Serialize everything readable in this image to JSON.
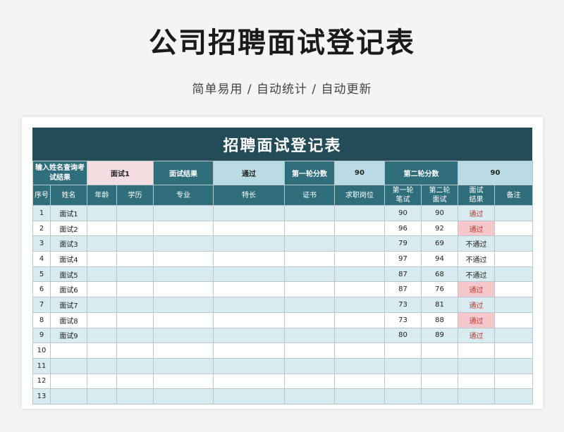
{
  "page": {
    "title": "公司招聘面试登记表",
    "subtitle": "简单易用 / 自动统计 / 自动更新"
  },
  "sheet": {
    "banner": "招聘面试登记表",
    "query": {
      "label": "输入姓名查询考试结果",
      "name_value": "面试1",
      "result_label": "面试结果",
      "result_value": "通过",
      "round1_label": "第一轮分数",
      "round1_value": "90",
      "round2_label": "第二轮分数",
      "round2_value": "90"
    },
    "columns": {
      "seq": "序号",
      "name": "姓名",
      "age": "年龄",
      "edu": "学历",
      "major": "专业",
      "skill": "特长",
      "cert": "证书",
      "position": "求职岗位",
      "round1": "第一轮笔试",
      "round2": "第二轮面试",
      "result": "面试结果",
      "remark": "备注"
    },
    "rows": [
      {
        "seq": "1",
        "name": "面试1",
        "r1": "90",
        "r2": "90",
        "result": "通过",
        "hl": false
      },
      {
        "seq": "2",
        "name": "面试2",
        "r1": "96",
        "r2": "92",
        "result": "通过",
        "hl": true
      },
      {
        "seq": "3",
        "name": "面试3",
        "r1": "79",
        "r2": "69",
        "result": "不通过",
        "hl": false
      },
      {
        "seq": "4",
        "name": "面试4",
        "r1": "97",
        "r2": "94",
        "result": "不通过",
        "hl": false
      },
      {
        "seq": "5",
        "name": "面试5",
        "r1": "87",
        "r2": "68",
        "result": "不通过",
        "hl": false
      },
      {
        "seq": "6",
        "name": "面试6",
        "r1": "87",
        "r2": "76",
        "result": "通过",
        "hl": true
      },
      {
        "seq": "7",
        "name": "面试7",
        "r1": "73",
        "r2": "81",
        "result": "通过",
        "hl": false
      },
      {
        "seq": "8",
        "name": "面试8",
        "r1": "73",
        "r2": "88",
        "result": "通过",
        "hl": true
      },
      {
        "seq": "9",
        "name": "面试9",
        "r1": "80",
        "r2": "89",
        "result": "通过",
        "hl": false
      },
      {
        "seq": "10",
        "name": "",
        "r1": "",
        "r2": "",
        "result": "",
        "hl": false
      },
      {
        "seq": "11",
        "name": "",
        "r1": "",
        "r2": "",
        "result": "",
        "hl": false
      },
      {
        "seq": "12",
        "name": "",
        "r1": "",
        "r2": "",
        "result": "",
        "hl": false
      },
      {
        "seq": "13",
        "name": "",
        "r1": "",
        "r2": "",
        "result": "",
        "hl": false
      }
    ]
  },
  "colors": {
    "banner": "#244c58",
    "header": "#2f6f7c",
    "row_band": "#d7ebf0",
    "pass_highlight": "#f6c8cd",
    "pass_text": "#c0392b"
  }
}
